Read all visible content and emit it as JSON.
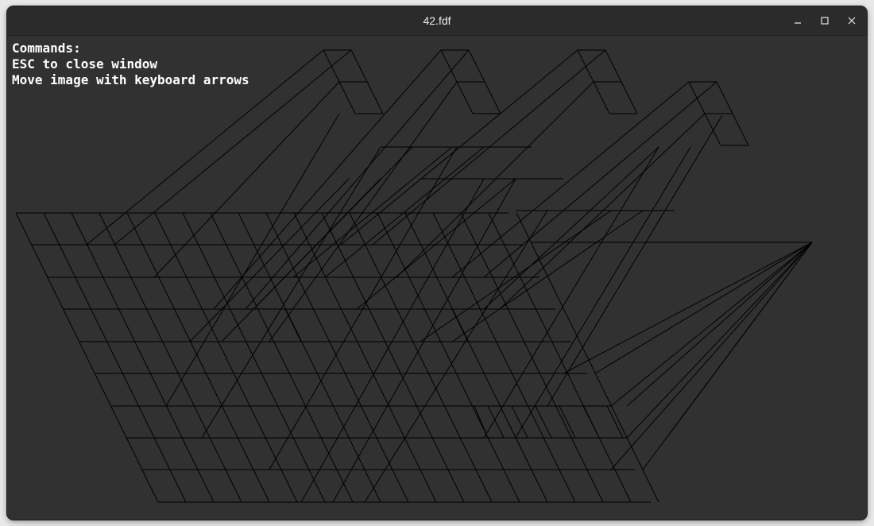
{
  "window": {
    "title": "42.fdf",
    "controls": {
      "minimize": "minimize-icon",
      "maximize": "maximize-icon",
      "close": "close-icon"
    }
  },
  "commands": {
    "heading": "Commands:",
    "esc": "ESC to close window",
    "move": "Move image with keyboard arrows"
  },
  "colors": {
    "background": "#313131",
    "titlebar": "#2b2b2b",
    "text": "#ffffff",
    "wire": "#000000"
  }
}
